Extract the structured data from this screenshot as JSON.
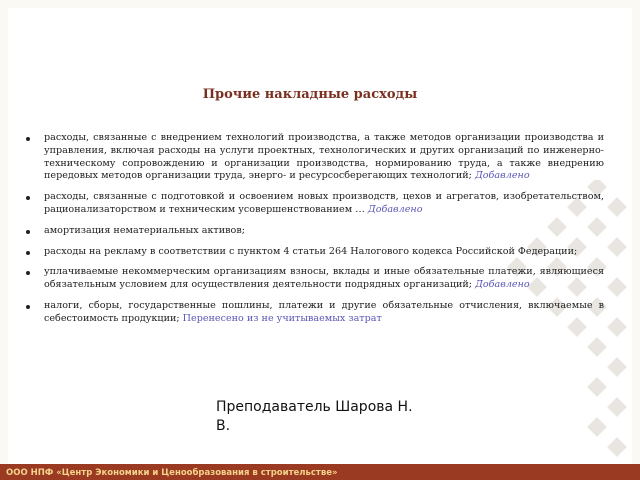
{
  "slide": {
    "title": "Прочие накладные расходы",
    "items": [
      {
        "text": "расходы, связанные с внедрением технологий производства, а также методов организации производства и управления, включая расходы на услуги проектных, технологических и других организаций по инженерно-техническому сопровождению и организации производства, нормированию труда, а также внедрению передовых методов организации труда, энерго- и ресурсосберегающих технологий;",
        "link": "Добавлено"
      },
      {
        "text": "расходы, связанные с подготовкой и освоением новых производств, цехов и агрегатов, изобретательством, рационализаторством и техническим усовершенствованием …",
        "link": "Добавлено"
      },
      {
        "text": "амортизация нематериальных активов;",
        "link": ""
      },
      {
        "text": "расходы на рекламу в соответствии с пунктом 4 статьи 264 Налогового кодекса Российской Федерации;",
        "link": ""
      },
      {
        "text": "уплачиваемые некоммерческим организациям взносы, вклады и иные обязательные платежи, являющиеся обязательным условием для осуществления деятельности подрядных организаций;",
        "link": "Добавлено"
      },
      {
        "text": "налоги, сборы, государственные пошлины, платежи и другие обязательные отчисления, включаемые в себестоимость продукции;",
        "link": "Перенесено из не учитываемых затрат"
      }
    ],
    "teacher": "Преподаватель Шарова Н. В."
  },
  "footer": {
    "company": "ООО НПФ «Центр Экономики и Ценообразования в строительстве»"
  },
  "colors": {
    "title": "#7a3020",
    "link": "#5b57b8",
    "footer_bar": "#9a3a22",
    "footer_text": "#f5d28a"
  }
}
